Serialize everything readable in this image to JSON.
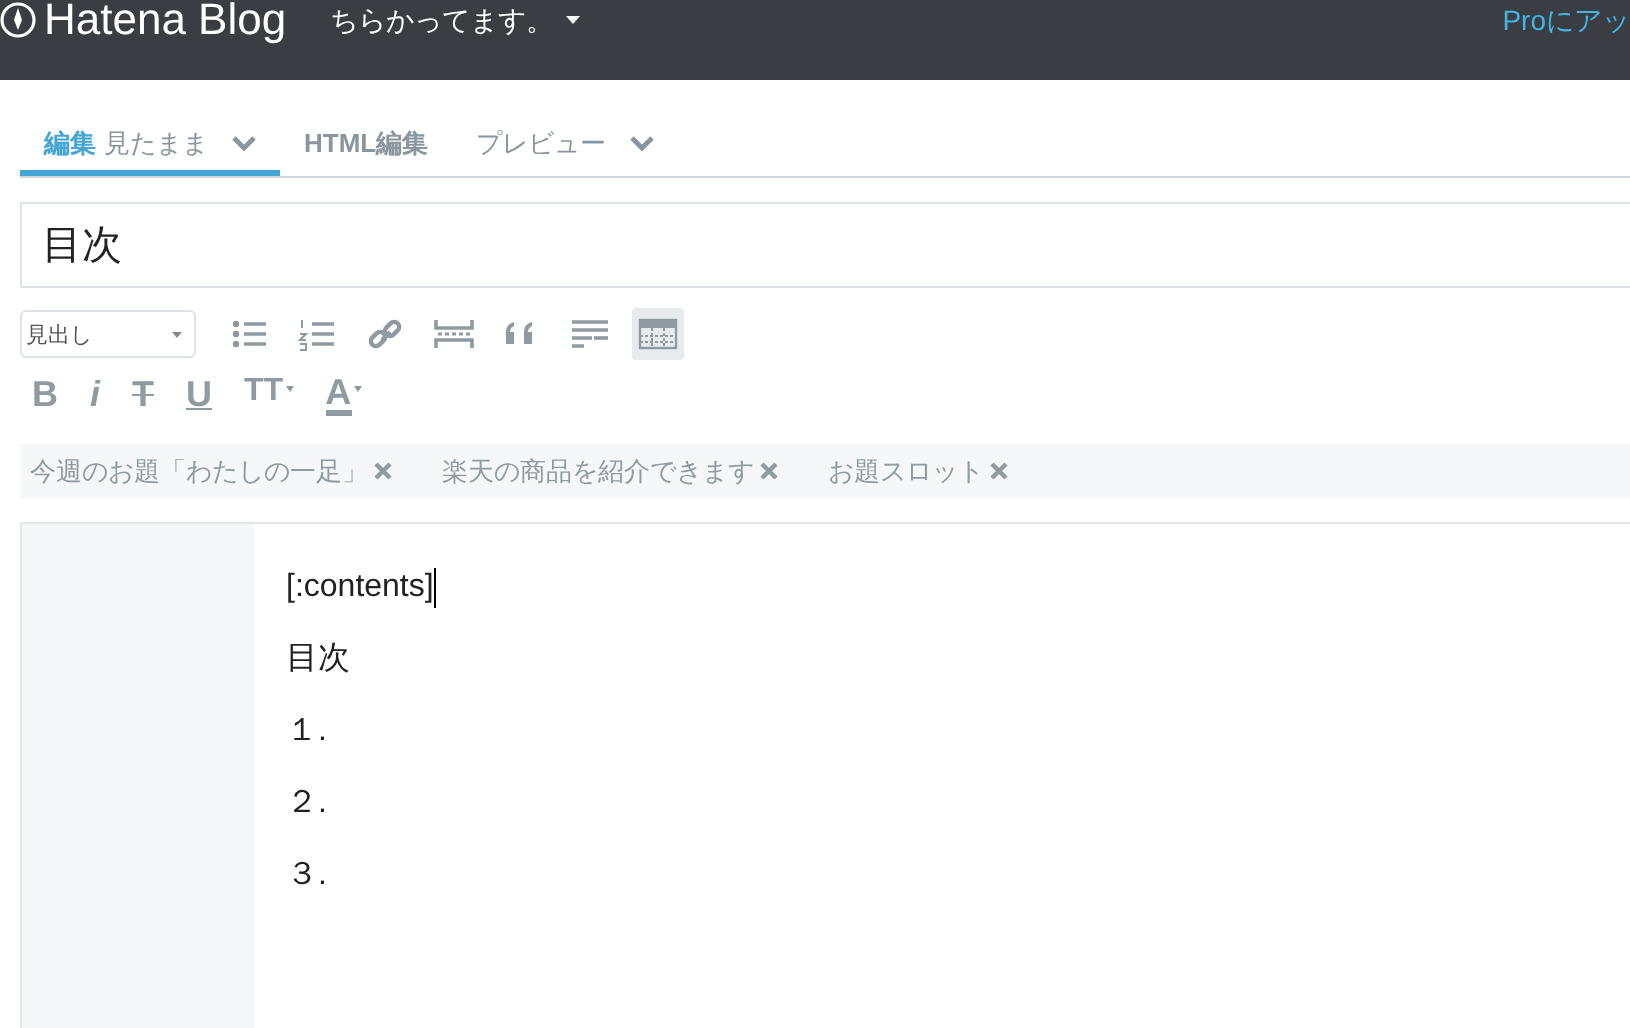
{
  "header": {
    "logo": "Hatena Blog",
    "blog_title": "ちらかってます。",
    "pro_link": "Proにアッ"
  },
  "tabs": [
    {
      "label": "編集",
      "sublabel": "見たまま",
      "menu": true,
      "selected": true
    },
    {
      "label": "HTML編集",
      "menu": false,
      "selected": false
    },
    {
      "label": "プレビュー",
      "menu": true,
      "selected": false
    }
  ],
  "title": "目次",
  "toolbar": {
    "format_select": "見出し",
    "row_1": [
      {
        "kind": "bullet-list",
        "selected": false
      },
      {
        "kind": "numbered-list",
        "selected": false
      },
      {
        "kind": "link",
        "selected": false
      },
      {
        "kind": "more",
        "selected": false
      },
      {
        "kind": "quote",
        "selected": false
      },
      {
        "kind": "footnote",
        "selected": false
      },
      {
        "kind": "table",
        "selected": true
      }
    ],
    "row_2": [
      {
        "kind": "bold",
        "label": "B"
      },
      {
        "kind": "italic",
        "label": "i"
      },
      {
        "kind": "strike",
        "label": "T"
      },
      {
        "kind": "underline",
        "label": "U"
      },
      {
        "kind": "size",
        "label": "TT"
      },
      {
        "kind": "color",
        "label": "A"
      }
    ]
  },
  "topics": [
    {
      "label": "今週のお題「わたしの一足」"
    },
    {
      "label": "楽天の商品を紹介できます"
    },
    {
      "label": "お題スロット"
    }
  ],
  "editor": {
    "lines": [
      "[:contents]",
      "目次",
      "１.",
      "２.",
      "３."
    ]
  }
}
